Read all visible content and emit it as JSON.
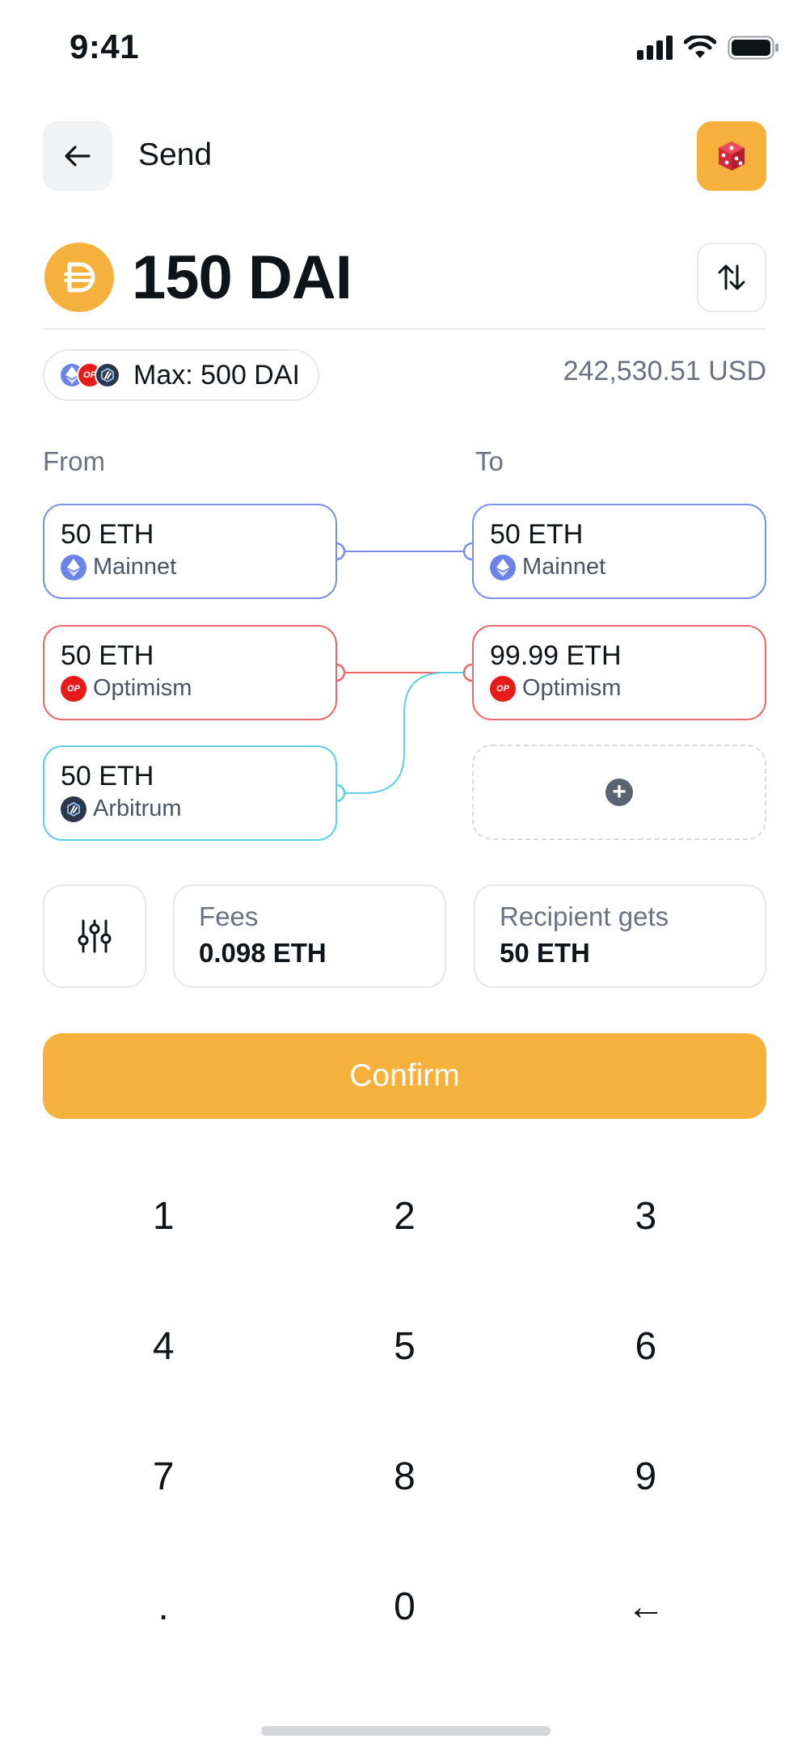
{
  "status_bar": {
    "time": "9:41"
  },
  "header": {
    "title": "Send",
    "back_icon": "arrow-left-icon",
    "dice_icon": "dice-icon"
  },
  "amount": {
    "value": "150 DAI",
    "token_icon": "dai-icon",
    "swap_icon": "swap-vertical-icon"
  },
  "max": {
    "label": "Max: 500 DAI",
    "chains": [
      "ethereum",
      "optimism",
      "arbitrum"
    ]
  },
  "usd_value": "242,530.51 USD",
  "route": {
    "from_label": "From",
    "to_label": "To",
    "from": [
      {
        "amount": "50 ETH",
        "chain": "Mainnet",
        "icon": "ethereum-icon",
        "color": "#7b8fe6"
      },
      {
        "amount": "50 ETH",
        "chain": "Optimism",
        "icon": "optimism-icon",
        "color": "#e86a6a"
      },
      {
        "amount": "50 ETH",
        "chain": "Arbitrum",
        "icon": "arbitrum-icon",
        "color": "#5fd0e6"
      }
    ],
    "to": [
      {
        "amount": "50 ETH",
        "chain": "Mainnet",
        "icon": "ethereum-icon",
        "color": "#7b8fe6"
      },
      {
        "amount": "99.99 ETH",
        "chain": "Optimism",
        "icon": "optimism-icon",
        "color": "#e86a6a"
      }
    ],
    "add_icon": "plus-circle-icon"
  },
  "fees": {
    "label": "Fees",
    "value": "0.098 ETH",
    "settings_icon": "sliders-icon"
  },
  "recipient": {
    "label": "Recipient gets",
    "value": "50 ETH"
  },
  "confirm_label": "Confirm",
  "keypad": [
    "1",
    "2",
    "3",
    "4",
    "5",
    "6",
    "7",
    "8",
    "9",
    ".",
    "0",
    "←"
  ],
  "colors": {
    "accent": "#f5b13b",
    "eth": "#6c84e8",
    "op": "#e81b1b",
    "arb": "#2d374b"
  }
}
